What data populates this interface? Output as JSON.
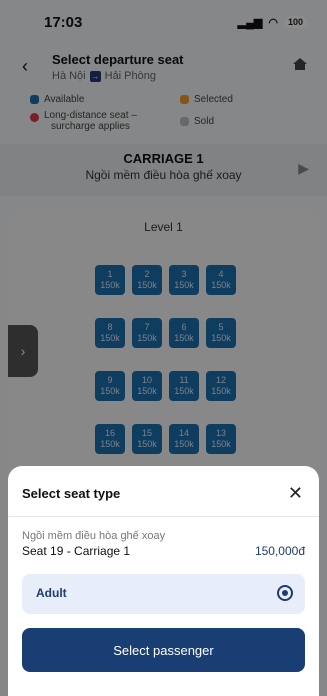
{
  "status_bar": {
    "time": "17:03",
    "signal": "::|",
    "wifi": "wifi",
    "battery": "100"
  },
  "header": {
    "title": "Select departure seat",
    "from": "Hà Nội",
    "to": "Hải Phòng"
  },
  "legend": {
    "available": "Available",
    "selected": "Selected",
    "long_distance": "Long-distance seat –",
    "long_distance_2": "surcharge applies",
    "sold": "Sold"
  },
  "carriage": {
    "title": "CARRIAGE 1",
    "subtitle": "Ngồi mềm điều hòa ghế xoay"
  },
  "seatmap": {
    "level": "Level 1",
    "seats": [
      {
        "num": "1",
        "price": "150k"
      },
      {
        "num": "2",
        "price": "150k"
      },
      {
        "num": "3",
        "price": "150k"
      },
      {
        "num": "4",
        "price": "150k"
      },
      {
        "num": "8",
        "price": "150k"
      },
      {
        "num": "7",
        "price": "150k"
      },
      {
        "num": "6",
        "price": "150k"
      },
      {
        "num": "5",
        "price": "150k"
      },
      {
        "num": "9",
        "price": "150k"
      },
      {
        "num": "10",
        "price": "150k"
      },
      {
        "num": "11",
        "price": "150k"
      },
      {
        "num": "12",
        "price": "150k"
      },
      {
        "num": "16",
        "price": "150k"
      },
      {
        "num": "15",
        "price": "150k"
      },
      {
        "num": "14",
        "price": "150k"
      },
      {
        "num": "13",
        "price": "150k"
      }
    ]
  },
  "bottom_sheet": {
    "title": "Select seat type",
    "seat_type": "Ngồi mềm điều hòa ghế xoay",
    "seat_info": "Seat 19 - Carriage 1",
    "price": "150,000đ",
    "passenger_type": "Adult",
    "button": "Select passenger"
  },
  "colors": {
    "available": "#1d6fb0",
    "selected": "#f39a2b",
    "long_distance": "#e0344c",
    "sold": "#b9bec7",
    "primary": "#183e74"
  }
}
